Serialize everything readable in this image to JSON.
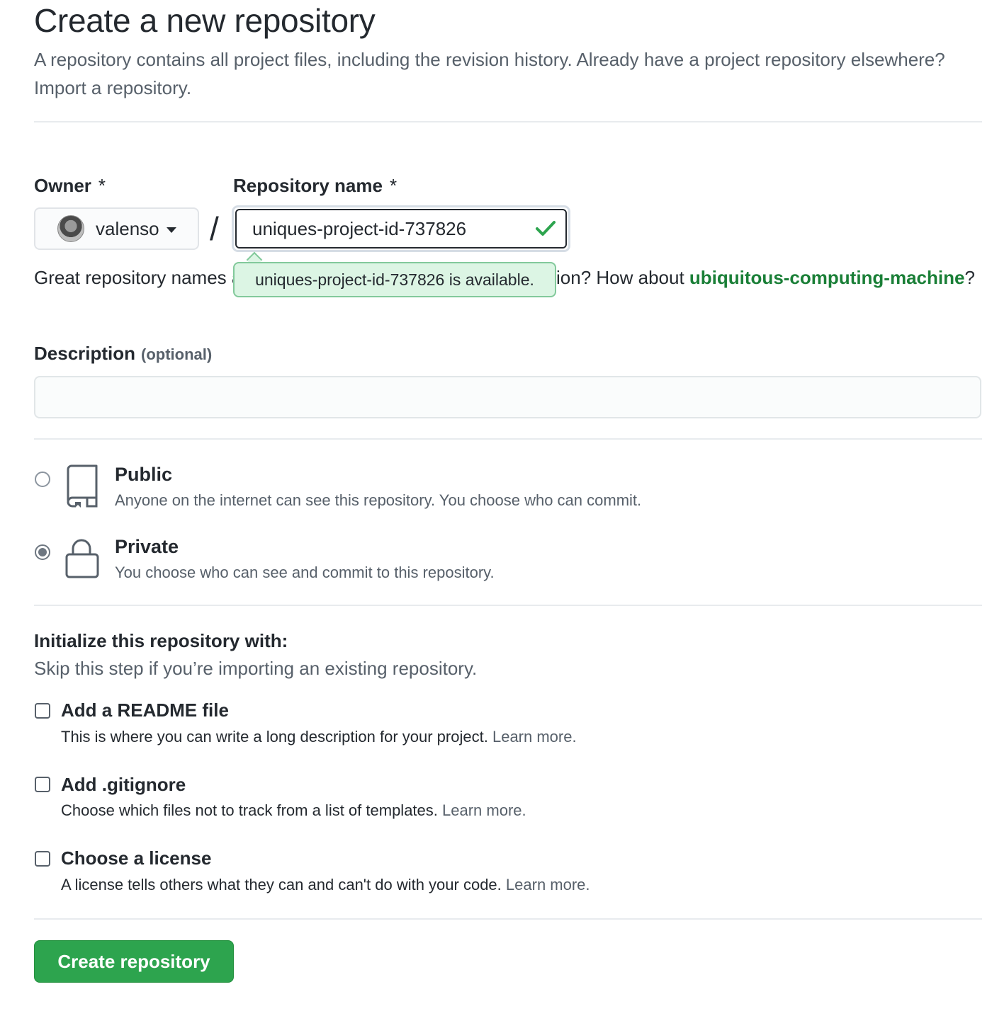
{
  "header": {
    "title": "Create a new repository",
    "intro_text": "A repository contains all project files, including the revision history. Already have a project repository elsewhere?",
    "import_link": "Import a repository."
  },
  "owner": {
    "label": "Owner",
    "required_mark": "*",
    "selected": "valenso"
  },
  "separator": "/",
  "repo_name": {
    "label": "Repository name",
    "required_mark": "*",
    "value": "uniques-project-id-737826",
    "availability_tooltip": "uniques-project-id-737826 is available."
  },
  "name_hint": {
    "prefix": "Great repository names are short and memorable. Need inspiration? How about ",
    "suggestion": "ubiquitous-computing-machine",
    "suffix": "?"
  },
  "description": {
    "label": "Description",
    "optional": "(optional)",
    "value": ""
  },
  "visibility": {
    "selected": "private",
    "options": [
      {
        "id": "public",
        "title": "Public",
        "desc": "Anyone on the internet can see this repository. You choose who can commit."
      },
      {
        "id": "private",
        "title": "Private",
        "desc": "You choose who can see and commit to this repository."
      }
    ]
  },
  "initialize": {
    "title": "Initialize this repository with:",
    "subtitle": "Skip this step if you’re importing an existing repository.",
    "options": [
      {
        "title": "Add a README file",
        "desc": "This is where you can write a long description for your project.",
        "link": "Learn more.",
        "checked": false
      },
      {
        "title": "Add .gitignore",
        "desc": "Choose which files not to track from a list of templates.",
        "link": "Learn more.",
        "checked": false
      },
      {
        "title": "Choose a license",
        "desc": "A license tells others what they can and can't do with your code.",
        "link": "Learn more.",
        "checked": false
      }
    ]
  },
  "submit": {
    "label": "Create repository"
  },
  "colors": {
    "primary_button": "#2da44e",
    "success": "#1a7f37",
    "tooltip_bg": "#dcf5e4"
  }
}
